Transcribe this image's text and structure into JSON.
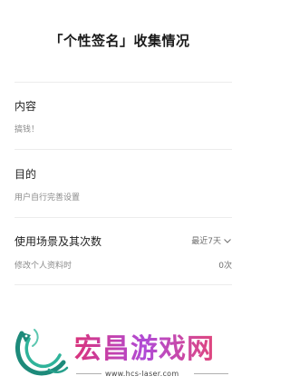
{
  "page": {
    "title": "「个性签名」收集情况"
  },
  "sections": [
    {
      "title": "内容",
      "value": "搞钱！"
    },
    {
      "title": "目的",
      "value": "用户自行完善设置"
    },
    {
      "title": "使用场景及其次数",
      "filter_label": "最近7天",
      "filter_icon": "chevron-down-icon",
      "scene_label": "修改个人资料时",
      "count": "0次"
    }
  ],
  "watermark": {
    "brand": "宏昌游戏网",
    "url": "www.hcs-laser.com",
    "logo_icon": "dragon-logo-icon"
  }
}
